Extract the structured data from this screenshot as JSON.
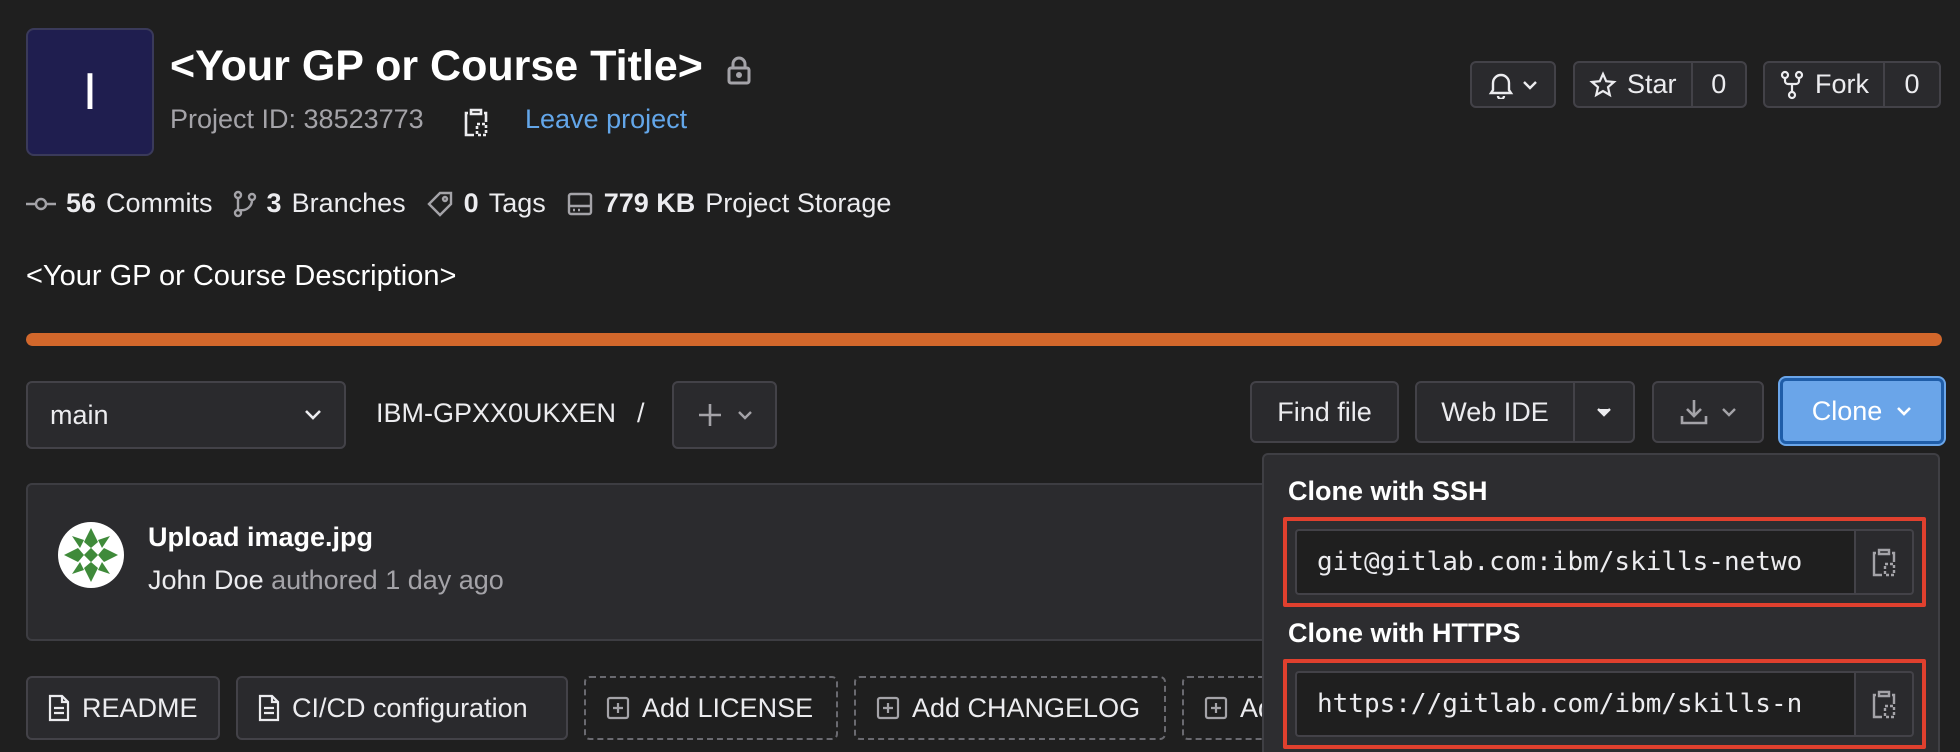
{
  "project": {
    "avatar_letter": "I",
    "title": "<Your GP or Course Title>",
    "id_text": "Project ID: 38523773",
    "leave_label": "Leave project",
    "description": "<Your GP or Course Description>"
  },
  "actions": {
    "star_label": "Star",
    "star_count": "0",
    "fork_label": "Fork",
    "fork_count": "0"
  },
  "stats": {
    "commits_count": "56",
    "commits_label": "Commits",
    "branches_count": "3",
    "branches_label": "Branches",
    "tags_count": "0",
    "tags_label": "Tags",
    "storage_size": "779 KB",
    "storage_label": "Project Storage"
  },
  "progress": {
    "fraction": 1.0,
    "color": "#d2672b"
  },
  "toolbar": {
    "branch": "main",
    "path": "IBM-GPXX0UKXEN",
    "separator": "/",
    "find_file": "Find file",
    "web_ide": "Web IDE",
    "clone": "Clone"
  },
  "commit": {
    "title": "Upload image.jpg",
    "author": "John Doe",
    "when": "authored 1 day ago"
  },
  "quick_actions": [
    {
      "label": "README"
    },
    {
      "label": "CI/CD configuration"
    },
    {
      "label": "Add LICENSE"
    },
    {
      "label": "Add CHANGELOG"
    },
    {
      "label": "Ad"
    }
  ],
  "clone_panel": {
    "ssh_label": "Clone with SSH",
    "ssh_url": "git@gitlab.com:ibm/skills-netwo",
    "https_label": "Clone with HTTPS",
    "https_url": "https://gitlab.com/ibm/skills-n"
  },
  "colors": {
    "accent": "#6aa5e9",
    "link": "#63a6e9",
    "highlight": "#e0402e",
    "progress": "#d2672b"
  }
}
